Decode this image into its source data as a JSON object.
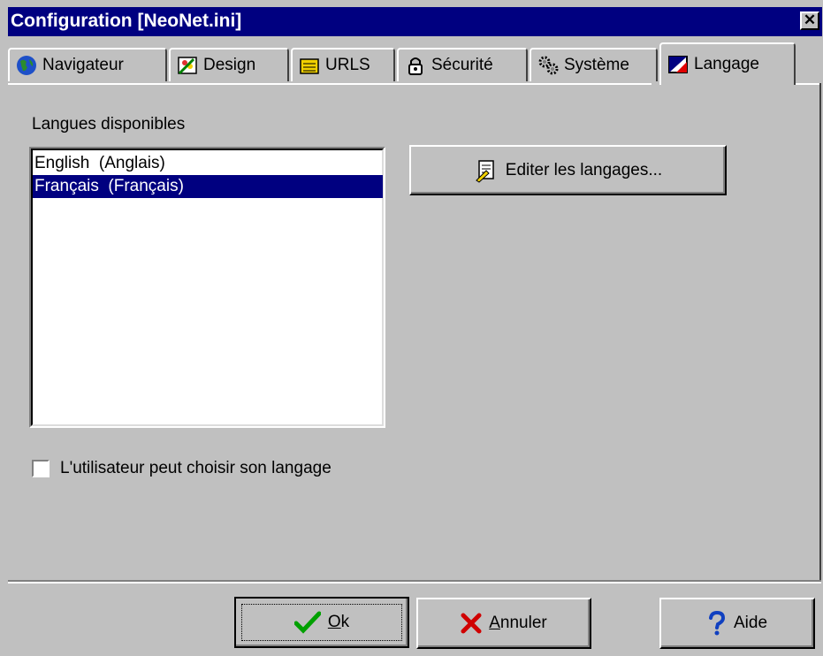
{
  "window": {
    "title": "Configuration [NeoNet.ini]",
    "close_symbol": "✕"
  },
  "tabs": [
    {
      "label": "Navigateur",
      "icon": "globe-icon"
    },
    {
      "label": "Design",
      "icon": "paint-icon"
    },
    {
      "label": "URLS",
      "icon": "folder-icon"
    },
    {
      "label": "Sécurité",
      "icon": "lock-icon"
    },
    {
      "label": "Système",
      "icon": "gears-icon"
    },
    {
      "label": "Langage",
      "icon": "flag-icon",
      "active": true
    }
  ],
  "languages": {
    "label": "Langues disponibles",
    "items": [
      {
        "text": "English  (Anglais)"
      },
      {
        "text": "Français  (Français)",
        "selected": true
      }
    ]
  },
  "edit_button": {
    "label": "Editer les langages...",
    "icon": "edit-document-icon"
  },
  "checkbox": {
    "label": "L'utilisateur peut choisir son langage",
    "checked": false
  },
  "footer": {
    "ok": {
      "prefix": "",
      "mnemonic": "O",
      "rest": "k",
      "icon": "checkmark-icon"
    },
    "cancel": {
      "mnemonic": "A",
      "rest": "nnuler",
      "icon": "x-icon"
    },
    "help": {
      "label": "Aide",
      "icon": "question-icon"
    }
  },
  "colors": {
    "title_bar": "#000080",
    "face": "#c0c0c0",
    "selection": "#000080"
  }
}
